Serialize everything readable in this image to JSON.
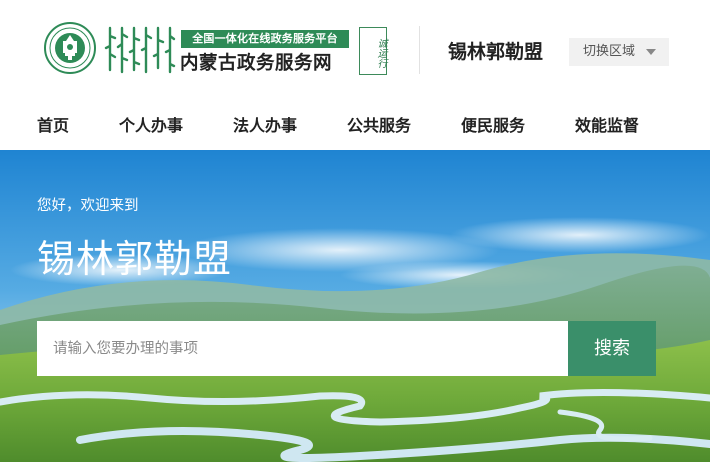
{
  "header": {
    "tagline": "全国一体化在线政务服务平台",
    "site_name": "内蒙古政务服务网",
    "seal_text": "诚运行",
    "region_name": "锡林郭勒盟",
    "switch_region_label": "切换区域",
    "emblem_icon": "emblem-icon",
    "mongolian_script_icon": "mongolian-script-icon"
  },
  "nav": {
    "items": [
      {
        "label": "首页"
      },
      {
        "label": "个人办事"
      },
      {
        "label": "法人办事"
      },
      {
        "label": "公共服务"
      },
      {
        "label": "便民服务"
      },
      {
        "label": "效能监督"
      }
    ]
  },
  "hero": {
    "greeting": "您好，欢迎来到",
    "title": "锡林郭勒盟",
    "search_placeholder": "请输入您要办理的事项",
    "search_button_label": "搜索"
  },
  "colors": {
    "brand_green": "#2e8b57",
    "search_button": "#3a8f6a",
    "sky_top": "#2c8fd6",
    "grass": "#6ea93a"
  }
}
